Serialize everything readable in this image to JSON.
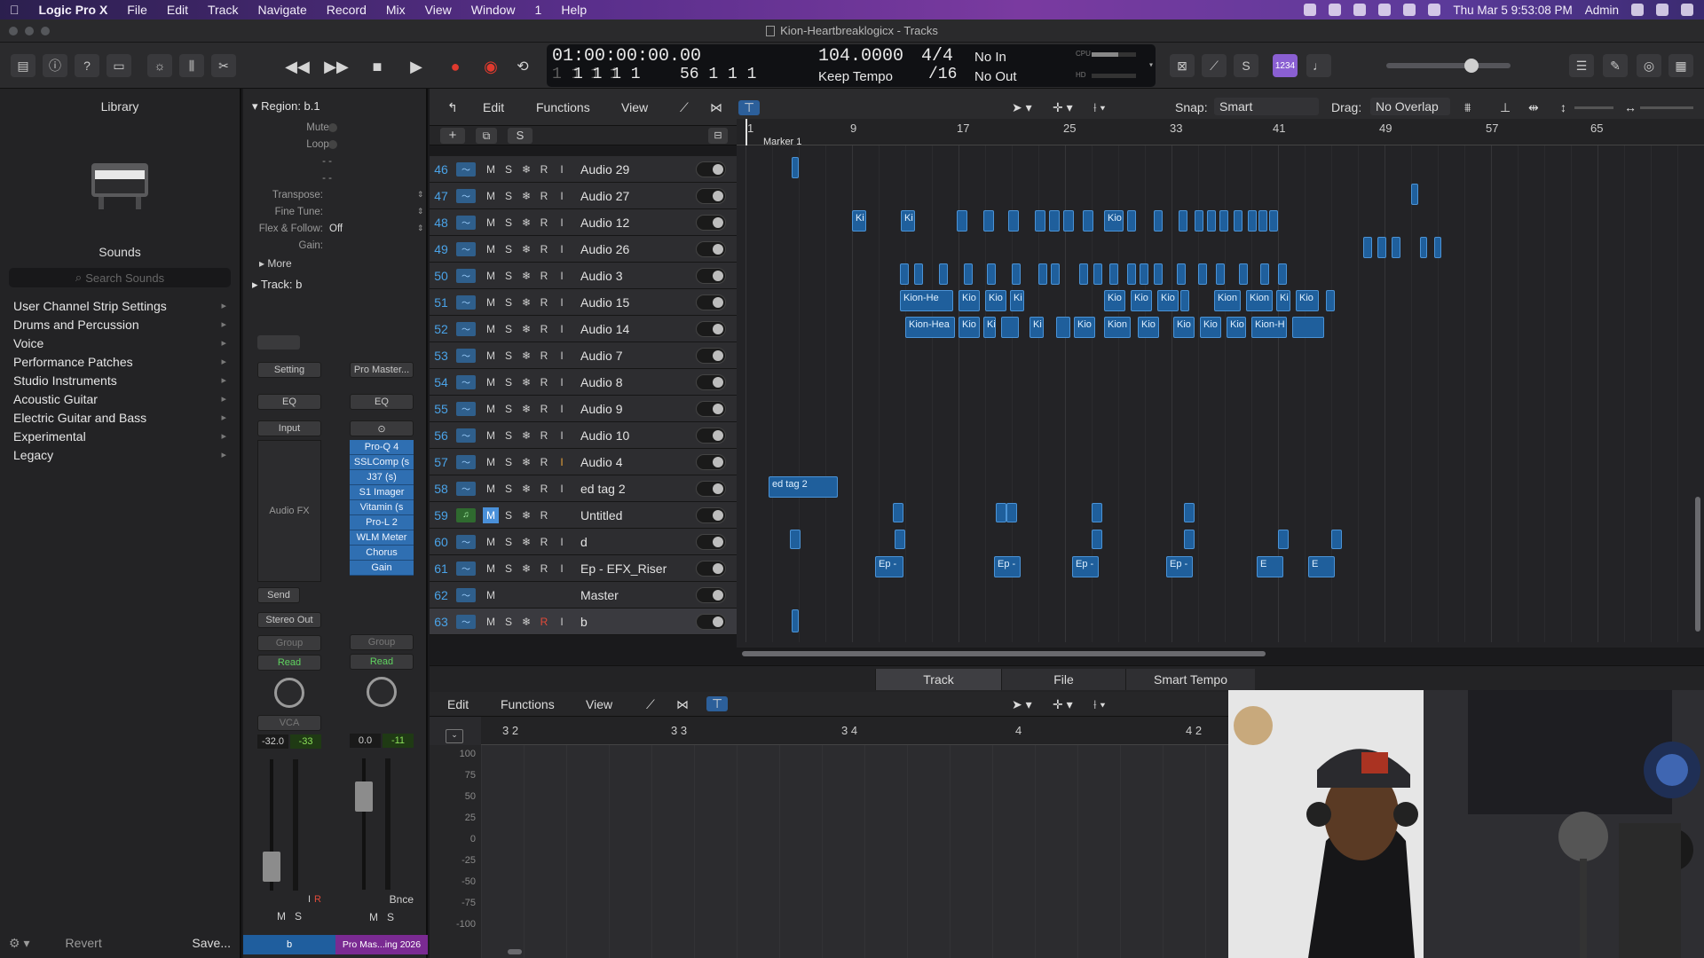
{
  "menubar": {
    "app": "Logic Pro X",
    "items": [
      "File",
      "Edit",
      "Track",
      "Navigate",
      "Record",
      "Mix",
      "View",
      "Window",
      "1",
      "Help"
    ],
    "clock": "Thu Mar 5  9:53:08 PM",
    "user": "Admin"
  },
  "window": {
    "title": "Kion-Heartbreaklogicx - Tracks"
  },
  "lcd": {
    "time": "01:00:00:00.00",
    "bar_pos_top": "1   1   1   1",
    "bar_pos": "1   1   1   1",
    "bar_end": "56   1   1   1",
    "tempo": "104.0000",
    "tempo_mode": "Keep Tempo",
    "sig": "4/4",
    "div": "/16",
    "in": "No In",
    "out": "No Out",
    "cpu": "CPU",
    "hd": "HD"
  },
  "library": {
    "title": "Library",
    "sounds": "Sounds",
    "search_placeholder": "Search Sounds",
    "categories": [
      "User Channel Strip Settings",
      "Drums and Percussion",
      "Voice",
      "Performance Patches",
      "Studio Instruments",
      "Acoustic Guitar",
      "Electric Guitar and Bass",
      "Experimental",
      "Legacy"
    ],
    "revert": "Revert",
    "save": "Save..."
  },
  "inspector": {
    "region_header": "Region: b.1",
    "mute": "Mute:",
    "loop": "Loop:",
    "dash1": "- -",
    "dash2": "- -",
    "transpose": "Transpose:",
    "finetune": "Fine Tune:",
    "flex": "Flex & Follow:",
    "flex_val": "Off",
    "gain": "Gain:",
    "more": "More",
    "track_header": "Track:",
    "track_name": "b",
    "setting": "Setting",
    "eq": "EQ",
    "input": "Input",
    "audio_fx": "Audio FX",
    "send": "Send",
    "stereo_out": "Stereo Out",
    "group": "Group",
    "read": "Read",
    "vca": "VCA",
    "vol_l": "-32.0",
    "peak_l": "-33",
    "master_preset": "Pro Master...",
    "plugins": [
      "Pro-Q 4",
      "SSLComp (s",
      "J37 (s)",
      "S1 Imager",
      "Vitamin (s",
      "Pro-L 2",
      "WLM Meter",
      "Chorus",
      "Gain"
    ],
    "vol_r": "0.0",
    "peak_r": "-11",
    "bnce": "Bnce",
    "ch_name_l": "b",
    "ch_name_r": "Pro Mas...ing 2026"
  },
  "tracks_toolbar": {
    "edit": "Edit",
    "functions": "Functions",
    "view": "View",
    "snap_label": "Snap:",
    "snap": "Smart",
    "drag_label": "Drag:",
    "drag": "No Overlap"
  },
  "ruler": {
    "ticks": [
      "1",
      "9",
      "17",
      "25",
      "33",
      "41",
      "49",
      "57",
      "65"
    ],
    "marker": "Marker 1"
  },
  "tracks": [
    {
      "num": "46",
      "name": "Audio 29"
    },
    {
      "num": "47",
      "name": "Audio 27"
    },
    {
      "num": "48",
      "name": "Audio 12"
    },
    {
      "num": "49",
      "name": "Audio 26"
    },
    {
      "num": "50",
      "name": "Audio 3"
    },
    {
      "num": "51",
      "name": "Audio 15"
    },
    {
      "num": "52",
      "name": "Audio 14"
    },
    {
      "num": "53",
      "name": "Audio 7"
    },
    {
      "num": "54",
      "name": "Audio 8"
    },
    {
      "num": "55",
      "name": "Audio 9"
    },
    {
      "num": "56",
      "name": "Audio 10"
    },
    {
      "num": "57",
      "name": "Audio 4"
    },
    {
      "num": "58",
      "name": "ed tag 2"
    },
    {
      "num": "59",
      "name": "Untitled"
    },
    {
      "num": "60",
      "name": "d"
    },
    {
      "num": "61",
      "name": "Ep - EFX_Riser"
    },
    {
      "num": "62",
      "name": "Master"
    },
    {
      "num": "63",
      "name": "b"
    }
  ],
  "regions": {
    "ki": "Ki",
    "kio": "Kio",
    "kion": "Kion",
    "kionhe": "Kion-He",
    "kionhea": "Kion-Hea",
    "kionh": "Kion-H",
    "edtag": "ed tag 2",
    "ep": "Ep -",
    "e": "E"
  },
  "editor": {
    "tabs": [
      "Track",
      "File",
      "Smart Tempo"
    ],
    "edit": "Edit",
    "functions": "Functions",
    "view": "View",
    "ruler": [
      "3 2",
      "3 3",
      "3 4",
      "4",
      "4 2"
    ],
    "scale": [
      "100",
      "75",
      "50",
      "25",
      "0",
      "-25",
      "-50",
      "-75",
      "-100"
    ]
  }
}
